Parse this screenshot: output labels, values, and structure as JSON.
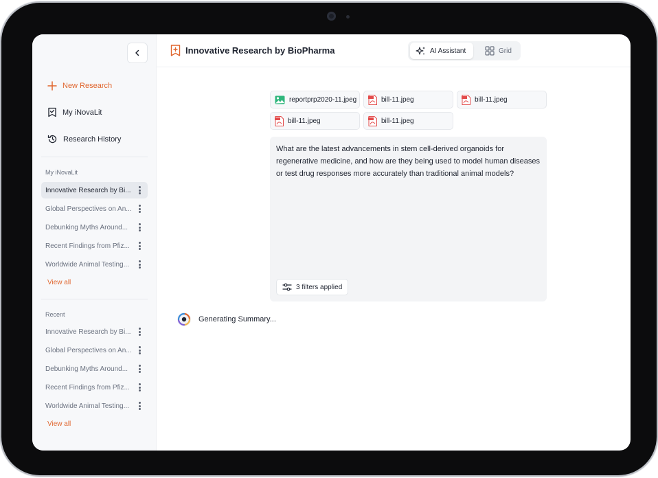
{
  "sidebar": {
    "nav": {
      "new_research": "New Research",
      "my_inovalit": "My iNovaLit",
      "research_history": "Research History"
    },
    "my_section": {
      "title": "My iNovaLit",
      "items": [
        "Innovative Research by Bi...",
        "Global Perspectives on An...",
        "Debunking Myths Around...",
        "Recent Findings from Pfiz...",
        "Worldwide Animal Testing..."
      ],
      "view_all": "View all"
    },
    "recent_section": {
      "title": "Recent",
      "items": [
        "Innovative Research by Bi...",
        "Global Perspectives on An...",
        "Debunking Myths Around...",
        "Recent Findings from Pfiz...",
        "Worldwide Animal Testing..."
      ],
      "view_all": "View all"
    }
  },
  "header": {
    "title": "Innovative Research by BioPharma",
    "toggle": {
      "ai_assistant": "AI Assistant",
      "grid": "Grid"
    }
  },
  "attachments": [
    {
      "name": "reportprp2020-11.jpeg",
      "icon": "image-file-icon"
    },
    {
      "name": "bill-11.jpeg",
      "icon": "pdf-file-icon"
    },
    {
      "name": "bill-11.jpeg",
      "icon": "pdf-file-icon"
    },
    {
      "name": "bill-11.jpeg",
      "icon": "pdf-file-icon"
    },
    {
      "name": "bill-11.jpeg",
      "icon": "pdf-file-icon"
    }
  ],
  "query": {
    "text": "What are the latest advancements in stem cell-derived organoids for regenerative medicine, and how are they being used to model human diseases or test drug responses more accurately than traditional animal models?",
    "filters_label": "3 filters applied"
  },
  "status": {
    "generating": "Generating Summary..."
  },
  "colors": {
    "accent": "#e0652d",
    "text": "#1f2430",
    "muted": "#6b7280"
  }
}
